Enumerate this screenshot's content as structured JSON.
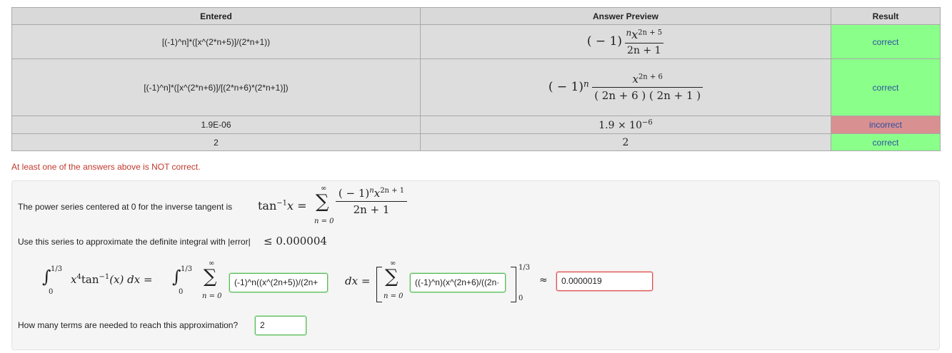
{
  "table": {
    "headers": [
      "Entered",
      "Answer Preview",
      "Result"
    ],
    "rows": [
      {
        "entered": "[(-1)^n]*([x^(2*n+5)]/(2*n+1))",
        "result": "correct"
      },
      {
        "entered": "[(-1)^n]*([x^(2*n+6)]/[(2*n+6)*(2*n+1)])",
        "result": "correct"
      },
      {
        "entered": "1.9E-06",
        "result": "incorrect"
      },
      {
        "entered": "2",
        "result": "correct"
      }
    ],
    "preview": {
      "row1": {
        "base": "( − 1)",
        "n": "n",
        "x": "x",
        "exp": "2n + 5",
        "den": "2n + 1"
      },
      "row2": {
        "base": "( − 1)",
        "n": "n",
        "x": "x",
        "exp": "2n + 6",
        "den": "( 2n + 6 ) ( 2n + 1 )"
      },
      "row3": {
        "mantissa": "1.9 × 10",
        "exp": "−6"
      },
      "row4": {
        "value": "2"
      }
    }
  },
  "warning": "At least one of the answers above is NOT correct.",
  "problem": {
    "intro": "The power series centered at 0 for the inverse tangent is",
    "tan_lhs": "tan",
    "tan_exp": "−1",
    "tan_var": "x =",
    "sum_top": "∞",
    "sum_bot": "n = 0",
    "series_num": "( − 1)",
    "series_n": "n",
    "series_x": "x",
    "series_exp": "2n + 1",
    "series_den": "2n + 1",
    "instruction": "Use this series to approximate the definite integral with |error|",
    "leq": "≤ 0.000004",
    "integral": {
      "upper": "1/3",
      "lower": "0",
      "integrand": "x",
      "x_exp": "4",
      "tan_text": "tan",
      "tan_exp": "−1",
      "tan_arg": "(x) dx =",
      "dx": "dx =",
      "approx": "≈"
    },
    "inputs": {
      "series_term": "(-1)^n((x^(2n+5))/(2n+",
      "antiderivative": "((-1)^n)(x^(2n+6)/((2n·",
      "approx_value": "0.0000019",
      "terms": "2"
    },
    "terms_question": "How many terms are needed to reach this approximation?"
  }
}
